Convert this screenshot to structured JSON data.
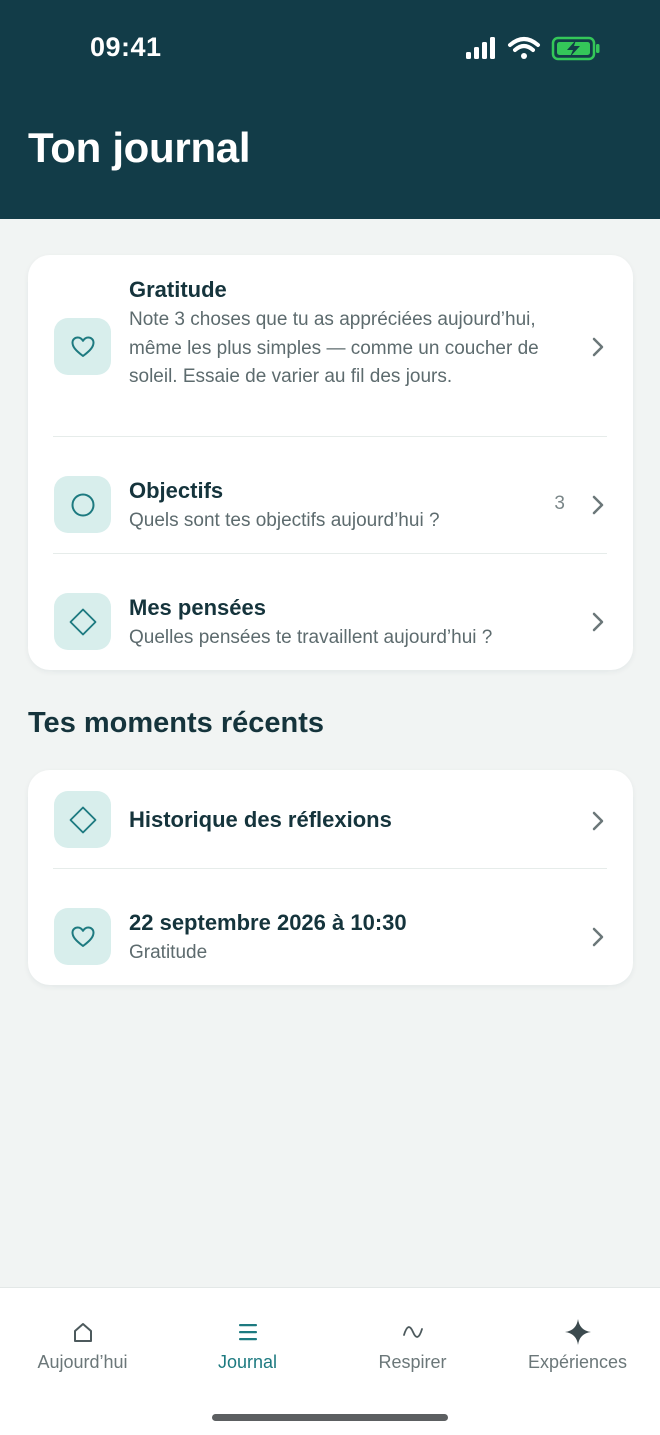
{
  "status_bar": {
    "time": "09:41"
  },
  "header": {
    "title": "Ton journal"
  },
  "journal_card": {
    "items": [
      {
        "title": "Gratitude",
        "subtitle": "Note 3 choses que tu as appréciées aujourd’hui, même les plus simples — comme un coucher de soleil. Essaie de varier au fil des jours.",
        "icon": "heart-icon"
      },
      {
        "title": "Objectifs",
        "subtitle": "Quels sont tes objectifs aujourd’hui ?",
        "count": "3",
        "icon": "circle-icon"
      },
      {
        "title": "Mes pensées",
        "subtitle": "Quelles pensées te travaillent aujourd’hui ?",
        "icon": "diamond-icon"
      }
    ]
  },
  "recent_section": {
    "title": "Tes moments récents",
    "items": [
      {
        "title": "Historique des réflexions",
        "icon": "diamond-icon"
      },
      {
        "title": "22 septembre 2026 à 10:30",
        "subtitle": "Gratitude",
        "icon": "heart-icon"
      }
    ]
  },
  "tabbar": {
    "tabs": [
      {
        "label": "Aujourd’hui",
        "icon": "home-icon",
        "active": false
      },
      {
        "label": "Journal",
        "icon": "list-icon",
        "active": true
      },
      {
        "label": "Respirer",
        "icon": "wave-icon",
        "active": false
      },
      {
        "label": "Expériences",
        "icon": "sparkle-icon",
        "active": false
      }
    ]
  },
  "colors": {
    "header_bg": "#123c48",
    "accent": "#1d7a80",
    "icon_tile_bg": "#d8eeec",
    "page_bg": "#f1f4f3",
    "battery_green": "#34c759"
  }
}
